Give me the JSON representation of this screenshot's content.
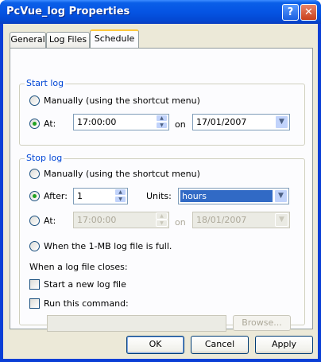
{
  "window": {
    "title": "PcVue_log Properties",
    "help_glyph": "?",
    "close_glyph": "✕"
  },
  "tabs": [
    {
      "label": "General"
    },
    {
      "label": "Log Files"
    },
    {
      "label": "Schedule",
      "active": true
    }
  ],
  "start_log": {
    "legend": "Start log",
    "manual_label": "Manually (using the shortcut menu)",
    "at_label": "At:",
    "time_value": "17:00:00",
    "on_label": "on",
    "date_value": "17/01/2007",
    "selected": "at"
  },
  "stop_log": {
    "legend": "Stop log",
    "manual_label": "Manually (using the shortcut menu)",
    "after_label": "After:",
    "after_value": "1",
    "units_label": "Units:",
    "units_value": "hours",
    "at_label": "At:",
    "at_time_value": "17:00:00",
    "on_label": "on",
    "at_date_value": "18/01/2007",
    "full_label": "When the 1-MB log file is full.",
    "selected": "after",
    "closes_label": "When a log file closes:",
    "new_log_label": "Start a new log file",
    "run_cmd_label": "Run this command:",
    "command_value": "",
    "browse_label": "Browse..."
  },
  "footer": {
    "ok_label": "OK",
    "cancel_label": "Cancel",
    "apply_label": "Apply"
  },
  "colors": {
    "titlebar": "#0554e3",
    "legend_text": "#0046d5",
    "selection": "#316ac5"
  }
}
